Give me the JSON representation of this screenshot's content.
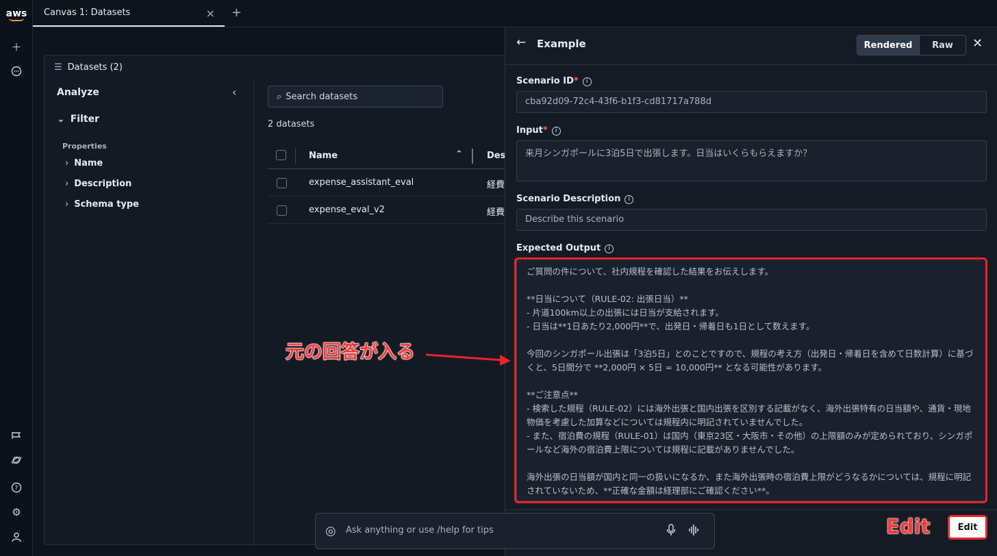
{
  "brand": "aws",
  "tab": {
    "title": "Canvas 1: Datasets",
    "close": "×",
    "add": "+"
  },
  "rail_icons": [
    "plus-icon",
    "chat-icon",
    "megaphone-icon",
    "planet-icon",
    "help-icon",
    "gear-icon",
    "user-icon"
  ],
  "workspace": {
    "title": "Datasets (2)",
    "analyze": "Analyze",
    "filter": "Filter",
    "properties_heading": "Properties",
    "properties": [
      "Name",
      "Description",
      "Schema type"
    ],
    "search_placeholder": "Search datasets",
    "count": "2 datasets",
    "columns": [
      "Name",
      "Descr"
    ],
    "rows": [
      {
        "name": "expense_assistant_eval",
        "desc": "経費"
      },
      {
        "name": "expense_eval_v2",
        "desc": "経費"
      }
    ]
  },
  "drawer": {
    "title": "Example",
    "view_modes": [
      "Rendered",
      "Raw"
    ],
    "active_mode": "Rendered",
    "scenario_id_label": "Scenario ID",
    "scenario_id": "cba92d09-72c4-43f6-b1f3-cd81717a788d",
    "input_label": "Input",
    "input": "来月シンガポールに3泊5日で出張します。日当はいくらもらえますか？",
    "description_label": "Scenario Description",
    "description_placeholder": "Describe this scenario",
    "expected_label": "Expected Output",
    "expected_output": "ご質問の件について、社内規程を確認した結果をお伝えします。\n\n**日当について（RULE-02: 出張日当）**\n- 片道100km以上の出張には日当が支給されます。\n- 日当は**1日あたり2,000円**で、出発日・帰着日も1日として数えます。\n\n今回のシンガポール出張は「3泊5日」とのことですので、規程の考え方（出発日・帰着日を含めて日数計算）に基づくと、5日間分で **2,000円 × 5日 = 10,000円** となる可能性があります。\n\n**ご注意点**\n- 検索した規程（RULE-02）には海外出張と国内出張を区別する記載がなく、海外出張特有の日当額や、通貨・現地物価を考慮した加算などについては規程内に明記されていませんでした。\n- また、宿泊費の規程（RULE-01）は国内（東京23区・大阪市・その他）の上限額のみが定められており、シンガポールなど海外の宿泊費上限については規程に記載がありませんでした。\n\n海外出張の日当額が国内と同一の扱いになるか、また海外出張時の宿泊費上限がどうなるかについては、規程に明記されていないため、**正確な金額は経理部にご確認ください**。",
    "edit_button": "Edit"
  },
  "annotations": {
    "original_answer": "元の回答が入る",
    "edit": "Edit",
    "highlight_color": "#e8242a"
  },
  "chat": {
    "placeholder": "Ask anything or use  /help for tips"
  }
}
